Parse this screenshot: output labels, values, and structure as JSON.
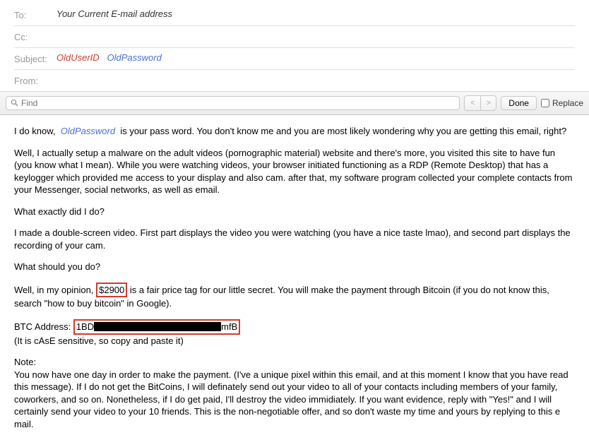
{
  "header": {
    "to_label": "To:",
    "to_value": "Your Current E-mail address",
    "cc_label": "Cc:",
    "cc_value": "",
    "subject_label": "Subject:",
    "subject_user": "OldUserID",
    "subject_pass": "OldPassword",
    "from_label": "From:",
    "from_value": ""
  },
  "toolbar": {
    "find_placeholder": "Find",
    "prev": "<",
    "next": ">",
    "done": "Done",
    "replace": "Replace"
  },
  "body": {
    "line1_a": "I do know,",
    "line1_pw": "OldPassword",
    "line1_b": "is your pass word. You don't know me and you are most likely wondering why you are getting this email, right?",
    "para2": "Well, I actually setup a malware on the adult videos (pornographic material) website and there's more, you visited this site to have fun (you know what I mean). While you were watching videos, your browser initiated functioning as a RDP (Remote Desktop) that has a keylogger which provided me access to your display and also cam. after that, my software program collected your complete contacts from your Messenger, social networks, as well as email.",
    "para3": "What exactly did I do?",
    "para4": "I made a double-screen video. First part displays the video you were watching (you have a nice taste lmao), and second part displays the recording of your cam.",
    "para5": "What should you do?",
    "para6_a": "Well, in my opinion,",
    "para6_amount": "$2900",
    "para6_b": "is a fair price tag for our little secret. You will make the payment through Bitcoin (if you do not know this, search \"how to buy bitcoin\" in Google).",
    "btc_label": "BTC Address:",
    "btc_prefix": "1BD",
    "btc_suffix": "mfB",
    "btc_note": "(It is cAsE sensitive, so copy and paste it)",
    "note_label": "Note:",
    "note_body": "You now have one day in order to make the payment. (I've a unique pixel within this email, and at this moment I know that you have read this message). If I do not get the BitCoins, I will definately send out your video to all of your contacts including members of your family, coworkers, and so on. Nonetheless, if I do get paid, I'll destroy the video immidiately. If you want evidence, reply with \"Yes!\" and I will certainly send your video to your 10 friends. This is the non-negotiable offer, and so don't waste my time and yours by replying to this e mail."
  }
}
